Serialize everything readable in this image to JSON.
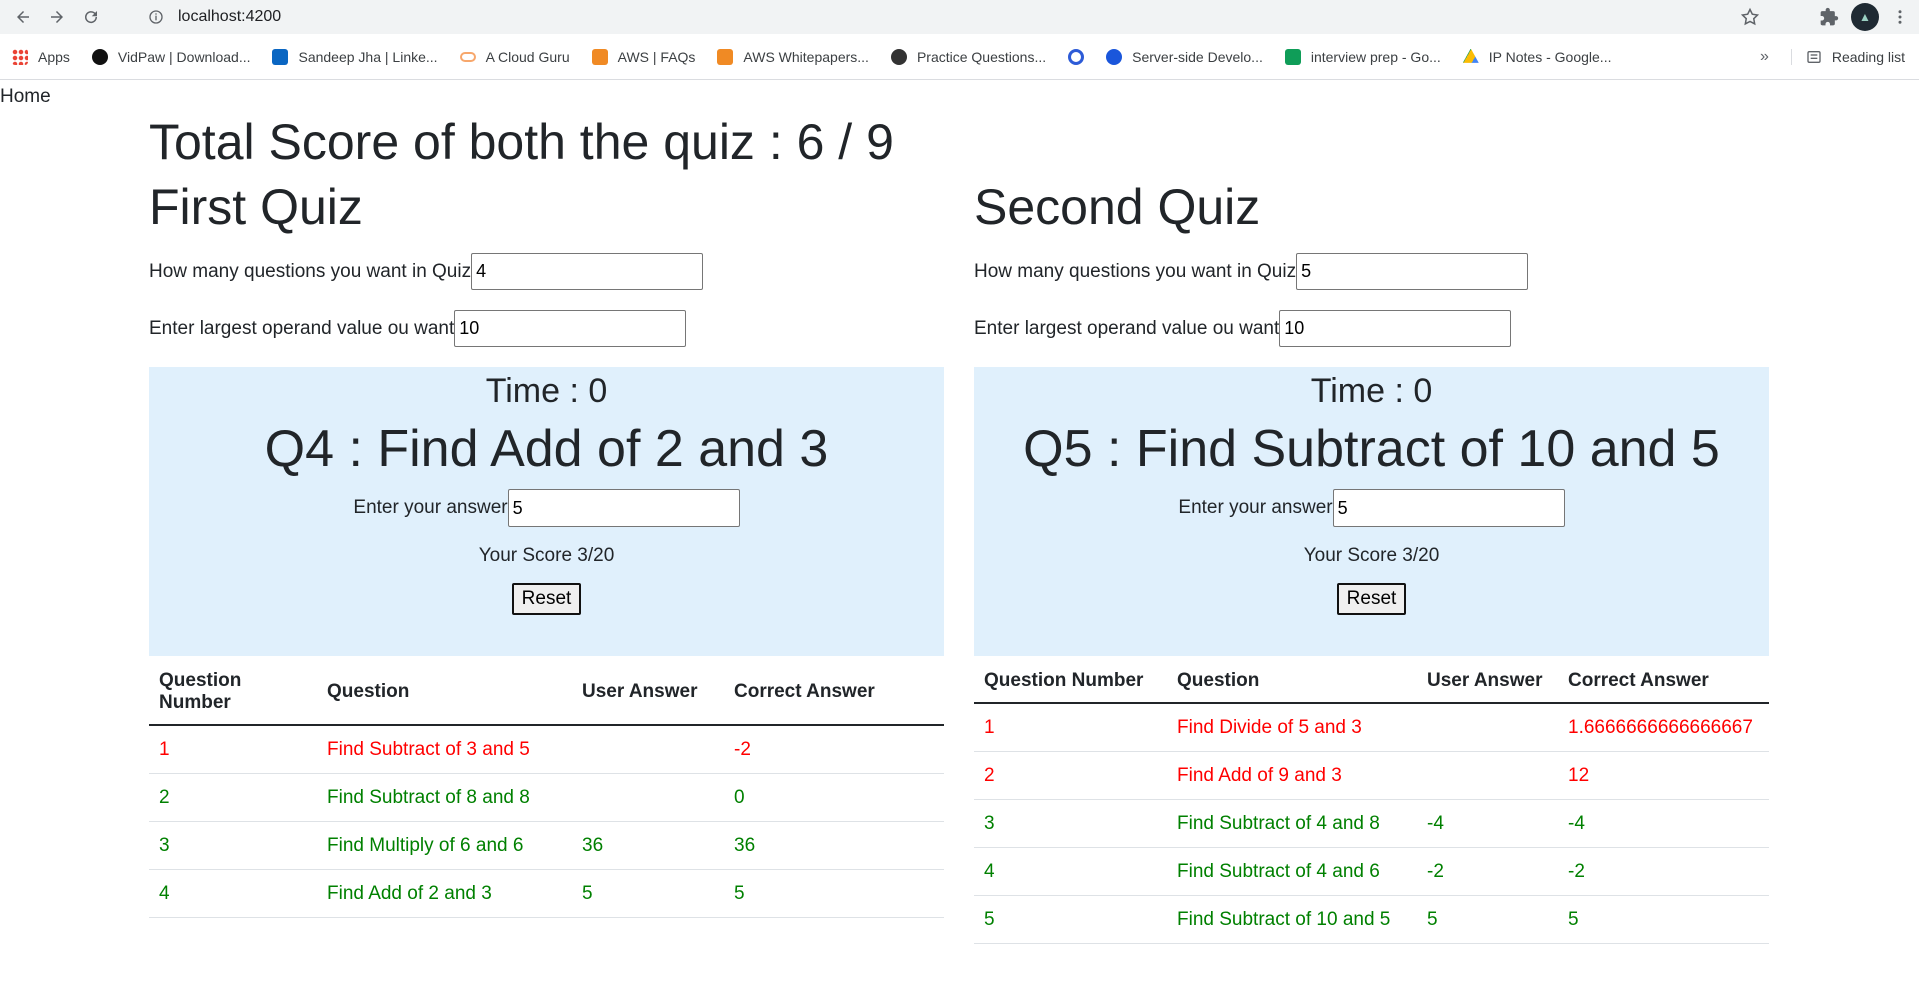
{
  "browser": {
    "url": "localhost:4200",
    "bookmarks": [
      {
        "label": "Apps",
        "icon": "apps-grid-icon",
        "color": "#4285f4"
      },
      {
        "label": "VidPaw | Download...",
        "icon": "vidpaw-icon",
        "color": "#111111"
      },
      {
        "label": "Sandeep Jha | Linke...",
        "icon": "linkedin-icon",
        "color": "#0a66c2"
      },
      {
        "label": "A Cloud Guru",
        "icon": "cloud-icon",
        "color": "#f7a76c"
      },
      {
        "label": "AWS | FAQs",
        "icon": "aws-cube-icon",
        "color": "#f08a24"
      },
      {
        "label": "AWS Whitepapers...",
        "icon": "aws-cube-icon",
        "color": "#f08a24"
      },
      {
        "label": "Practice Questions...",
        "icon": "robot-icon",
        "color": "#333333"
      },
      {
        "label": "",
        "icon": "q-icon",
        "color": "#2d5bd7"
      },
      {
        "label": "Server-side Develo...",
        "icon": "c-icon",
        "color": "#1a56db"
      },
      {
        "label": "interview prep - Go...",
        "icon": "sheets-icon",
        "color": "#0f9d58"
      },
      {
        "label": "IP Notes - Google...",
        "icon": "drive-icon",
        "color": "#fbbc04"
      }
    ],
    "reading_list": "Reading list",
    "more_chevron": "»"
  },
  "page": {
    "home_link": "Home",
    "total_score": "Total Score of both the quiz : 6 / 9"
  },
  "quizzes": [
    {
      "title": "First Quiz",
      "questions_label": "How many questions you want in Quiz",
      "questions_value": "4",
      "operand_label": "Enter largest operand value ou want",
      "operand_value": "10",
      "timer": "Time : 0",
      "question": "Q4 : Find Add of 2 and 3",
      "answer_label": "Enter your answer",
      "answer_value": "5",
      "score": "Your Score 3/20",
      "reset_label": "Reset",
      "headers": [
        "Question Number",
        "Question",
        "User Answer",
        "Correct Answer"
      ],
      "rows": [
        {
          "num": "1",
          "question": "Find Subtract of 3 and 5",
          "user": "",
          "correct": "-2",
          "status": "wrong"
        },
        {
          "num": "2",
          "question": "Find Subtract of 8 and 8",
          "user": "",
          "correct": "0",
          "status": "right"
        },
        {
          "num": "3",
          "question": "Find Multiply of 6 and 6",
          "user": "36",
          "correct": "36",
          "status": "right"
        },
        {
          "num": "4",
          "question": "Find Add of 2 and 3",
          "user": "5",
          "correct": "5",
          "status": "right"
        }
      ]
    },
    {
      "title": "Second Quiz",
      "questions_label": "How many questions you want in Quiz",
      "questions_value": "5",
      "operand_label": "Enter largest operand value ou want",
      "operand_value": "10",
      "timer": "Time : 0",
      "question": "Q5 : Find Subtract of 10 and 5",
      "answer_label": "Enter your answer",
      "answer_value": "5",
      "score": "Your Score 3/20",
      "reset_label": "Reset",
      "headers": [
        "Question Number",
        "Question",
        "User Answer",
        "Correct Answer"
      ],
      "rows": [
        {
          "num": "1",
          "question": "Find Divide of 5 and 3",
          "user": "",
          "correct": "1.6666666666666667",
          "status": "wrong"
        },
        {
          "num": "2",
          "question": "Find Add of 9 and 3",
          "user": "",
          "correct": "12",
          "status": "wrong"
        },
        {
          "num": "3",
          "question": "Find Subtract of 4 and 8",
          "user": "-4",
          "correct": "-4",
          "status": "right"
        },
        {
          "num": "4",
          "question": "Find Subtract of 4 and 6",
          "user": "-2",
          "correct": "-2",
          "status": "right"
        },
        {
          "num": "5",
          "question": "Find Subtract of 10 and 5",
          "user": "5",
          "correct": "5",
          "status": "right"
        }
      ]
    }
  ]
}
